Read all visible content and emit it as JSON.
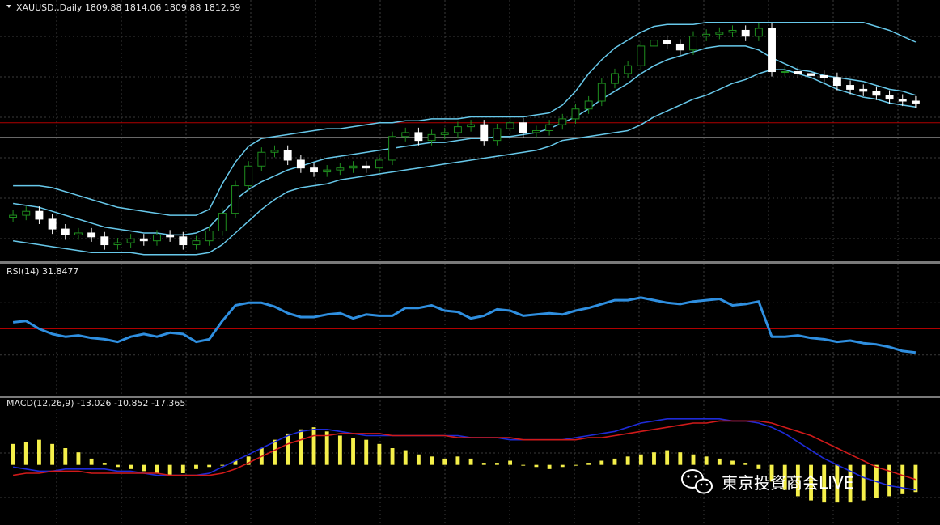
{
  "colors": {
    "background": "#000000",
    "grid": "#3a3a3a",
    "candle_up": "#1f8f1f",
    "candle_down": "#ffffff",
    "bollinger": "#67c8ea",
    "level": "#b00000",
    "rsi_line": "#2f8fe0",
    "macd_hist": "#f5f04a",
    "macd_main": "#1e2bd8",
    "macd_signal": "#d01a1a",
    "separator": "#7a7a7a"
  },
  "chart_data": [
    {
      "type": "candlestick",
      "header": "XAUUSD.,Daily  1809.88 1814.06 1809.88 1812.59",
      "symbol": "XAUUSD.",
      "timeframe": "Daily",
      "ohlc_current": [
        1809.88,
        1814.06,
        1809.88,
        1812.59
      ],
      "close": [
        1773,
        1775,
        1771,
        1766,
        1763,
        1764,
        1762,
        1758,
        1759,
        1761,
        1760,
        1763,
        1762,
        1758,
        1760,
        1765,
        1774,
        1788,
        1798,
        1805,
        1806,
        1801,
        1797,
        1795,
        1796,
        1797,
        1798,
        1797,
        1801,
        1813,
        1815,
        1811,
        1814,
        1815,
        1818,
        1819,
        1811,
        1817,
        1820,
        1815,
        1816,
        1819,
        1822,
        1827,
        1831,
        1840,
        1845,
        1849,
        1859,
        1862,
        1860,
        1857,
        1864,
        1865,
        1866,
        1867,
        1864,
        1868,
        1846,
        1846,
        1845,
        1844,
        1843,
        1839,
        1837,
        1836,
        1834,
        1832,
        1831,
        1830
      ],
      "bollinger_upper": [
        1788,
        1788,
        1788,
        1787,
        1785,
        1783,
        1781,
        1779,
        1777,
        1776,
        1775,
        1774,
        1773,
        1773,
        1773,
        1776,
        1789,
        1800,
        1808,
        1812,
        1813,
        1814,
        1815,
        1816,
        1817,
        1817,
        1818,
        1819,
        1820,
        1820,
        1821,
        1821,
        1822,
        1822,
        1822,
        1823,
        1823,
        1823,
        1823,
        1823,
        1824,
        1825,
        1829,
        1836,
        1845,
        1852,
        1858,
        1862,
        1866,
        1869,
        1870,
        1870,
        1870,
        1871,
        1871,
        1871,
        1871,
        1871,
        1871,
        1871,
        1871,
        1871,
        1871,
        1871,
        1871,
        1871,
        1869,
        1867,
        1864,
        1861
      ],
      "bollinger_middle": [
        1779,
        1778,
        1777,
        1775,
        1773,
        1771,
        1769,
        1767,
        1766,
        1765,
        1764,
        1764,
        1763,
        1763,
        1764,
        1767,
        1774,
        1781,
        1786,
        1790,
        1793,
        1796,
        1798,
        1800,
        1802,
        1803,
        1804,
        1805,
        1806,
        1807,
        1808,
        1809,
        1810,
        1810,
        1811,
        1812,
        1812,
        1813,
        1813,
        1814,
        1815,
        1817,
        1820,
        1823,
        1827,
        1832,
        1836,
        1840,
        1845,
        1849,
        1852,
        1854,
        1856,
        1858,
        1859,
        1859,
        1859,
        1857,
        1853,
        1850,
        1847,
        1846,
        1844,
        1843,
        1842,
        1841,
        1839,
        1837,
        1836,
        1834
      ],
      "bollinger_lower": [
        1760,
        1759,
        1758,
        1757,
        1756,
        1755,
        1754,
        1754,
        1754,
        1754,
        1753,
        1753,
        1753,
        1753,
        1753,
        1754,
        1758,
        1764,
        1770,
        1776,
        1781,
        1785,
        1787,
        1788,
        1789,
        1791,
        1792,
        1793,
        1794,
        1795,
        1796,
        1797,
        1798,
        1799,
        1800,
        1801,
        1802,
        1803,
        1804,
        1805,
        1806,
        1808,
        1811,
        1812,
        1813,
        1814,
        1815,
        1816,
        1819,
        1823,
        1826,
        1829,
        1832,
        1834,
        1837,
        1840,
        1842,
        1845,
        1847,
        1847,
        1845,
        1843,
        1840,
        1837,
        1835,
        1833,
        1832,
        1830,
        1829,
        1828
      ],
      "level_line": 1820,
      "current_price_line": 1812.59,
      "ylim": [
        1750,
        1875
      ]
    },
    {
      "type": "line",
      "header": "RSI(14) 31.8477",
      "name": "RSI(14)",
      "value": 31.8477,
      "values": [
        55,
        56,
        50,
        46,
        44,
        45,
        43,
        42,
        40,
        44,
        46,
        44,
        47,
        46,
        40,
        42,
        56,
        68,
        70,
        70,
        67,
        62,
        59,
        59,
        61,
        62,
        58,
        61,
        60,
        60,
        66,
        66,
        68,
        64,
        63,
        58,
        60,
        65,
        64,
        60,
        61,
        62,
        61,
        64,
        66,
        69,
        72,
        72,
        74,
        72,
        70,
        69,
        71,
        72,
        73,
        68,
        69,
        71,
        44,
        44,
        45,
        43,
        42,
        40,
        41,
        39,
        38,
        36,
        33,
        31.85
      ],
      "levels": [
        70,
        50,
        30
      ],
      "ylim": [
        0,
        100
      ]
    },
    {
      "type": "macd",
      "header": "MACD(12,26,9) -13.026 -10.852 -17.365",
      "name": "MACD(12,26,9)",
      "values": [
        -13.026,
        -10.852,
        -17.365
      ],
      "histogram": [
        10,
        11,
        12,
        10,
        8,
        6,
        3,
        1,
        -1,
        -2,
        -3,
        -4,
        -5,
        -4,
        -2,
        -1,
        0,
        2,
        4,
        8,
        12,
        15,
        17,
        18,
        16,
        14,
        13,
        12,
        10,
        8,
        7,
        5,
        4,
        3,
        4,
        3,
        1,
        1,
        2,
        0,
        -1,
        -2,
        -1,
        0,
        1,
        2,
        3,
        4,
        5,
        6,
        7,
        6,
        5,
        4,
        3,
        2,
        1,
        -2,
        -8,
        -12,
        -15,
        -17,
        -18,
        -18,
        -18,
        -17,
        -16,
        -15,
        -14,
        -13
      ],
      "main": [
        -1,
        -2,
        -3,
        -3,
        -2,
        -2,
        -2,
        -2,
        -3,
        -3,
        -4,
        -5,
        -5,
        -5,
        -5,
        -4,
        -1,
        2,
        5,
        8,
        11,
        14,
        16,
        17,
        17,
        16,
        15,
        14,
        14,
        14,
        14,
        14,
        14,
        14,
        14,
        13,
        13,
        13,
        12,
        12,
        12,
        12,
        12,
        13,
        14,
        15,
        16,
        18,
        20,
        21,
        22,
        22,
        22,
        22,
        22,
        21,
        21,
        20,
        18,
        15,
        11,
        7,
        3,
        0,
        -3,
        -6,
        -8,
        -10,
        -11,
        -12
      ],
      "signal": [
        -5,
        -4,
        -4,
        -3,
        -3,
        -3,
        -4,
        -4,
        -4,
        -4,
        -4,
        -4,
        -5,
        -5,
        -5,
        -5,
        -4,
        -2,
        1,
        4,
        7,
        10,
        12,
        14,
        14,
        15,
        15,
        15,
        15,
        14,
        14,
        14,
        14,
        14,
        13,
        13,
        13,
        13,
        13,
        12,
        12,
        12,
        12,
        12,
        13,
        13,
        14,
        15,
        16,
        17,
        18,
        19,
        20,
        20,
        21,
        21,
        21,
        21,
        20,
        18,
        16,
        14,
        11,
        8,
        5,
        2,
        -1,
        -3,
        -5,
        -7
      ]
    }
  ],
  "watermark": {
    "icon": "wechat-icon",
    "text": "東京投資商会LIVE"
  }
}
